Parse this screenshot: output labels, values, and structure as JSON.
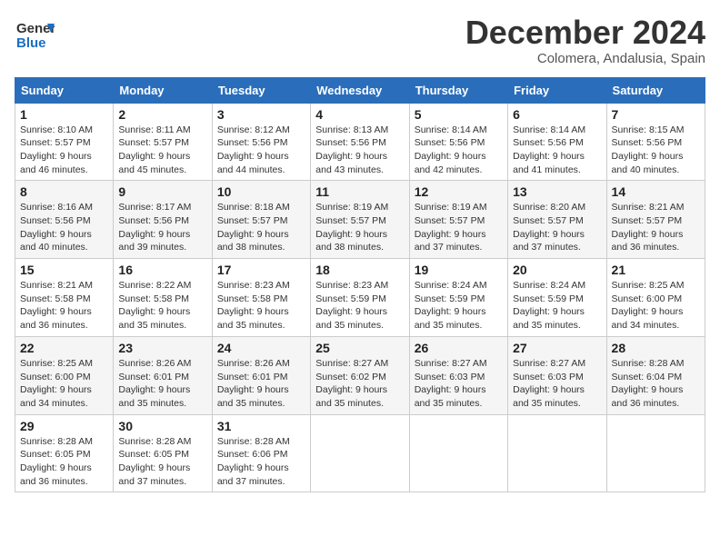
{
  "logo": {
    "line1": "General",
    "line2": "Blue"
  },
  "title": "December 2024",
  "subtitle": "Colomera, Andalusia, Spain",
  "days_of_week": [
    "Sunday",
    "Monday",
    "Tuesday",
    "Wednesday",
    "Thursday",
    "Friday",
    "Saturday"
  ],
  "weeks": [
    [
      {
        "day": "1",
        "info": "Sunrise: 8:10 AM\nSunset: 5:57 PM\nDaylight: 9 hours\nand 46 minutes."
      },
      {
        "day": "2",
        "info": "Sunrise: 8:11 AM\nSunset: 5:57 PM\nDaylight: 9 hours\nand 45 minutes."
      },
      {
        "day": "3",
        "info": "Sunrise: 8:12 AM\nSunset: 5:56 PM\nDaylight: 9 hours\nand 44 minutes."
      },
      {
        "day": "4",
        "info": "Sunrise: 8:13 AM\nSunset: 5:56 PM\nDaylight: 9 hours\nand 43 minutes."
      },
      {
        "day": "5",
        "info": "Sunrise: 8:14 AM\nSunset: 5:56 PM\nDaylight: 9 hours\nand 42 minutes."
      },
      {
        "day": "6",
        "info": "Sunrise: 8:14 AM\nSunset: 5:56 PM\nDaylight: 9 hours\nand 41 minutes."
      },
      {
        "day": "7",
        "info": "Sunrise: 8:15 AM\nSunset: 5:56 PM\nDaylight: 9 hours\nand 40 minutes."
      }
    ],
    [
      {
        "day": "8",
        "info": "Sunrise: 8:16 AM\nSunset: 5:56 PM\nDaylight: 9 hours\nand 40 minutes."
      },
      {
        "day": "9",
        "info": "Sunrise: 8:17 AM\nSunset: 5:56 PM\nDaylight: 9 hours\nand 39 minutes."
      },
      {
        "day": "10",
        "info": "Sunrise: 8:18 AM\nSunset: 5:57 PM\nDaylight: 9 hours\nand 38 minutes."
      },
      {
        "day": "11",
        "info": "Sunrise: 8:19 AM\nSunset: 5:57 PM\nDaylight: 9 hours\nand 38 minutes."
      },
      {
        "day": "12",
        "info": "Sunrise: 8:19 AM\nSunset: 5:57 PM\nDaylight: 9 hours\nand 37 minutes."
      },
      {
        "day": "13",
        "info": "Sunrise: 8:20 AM\nSunset: 5:57 PM\nDaylight: 9 hours\nand 37 minutes."
      },
      {
        "day": "14",
        "info": "Sunrise: 8:21 AM\nSunset: 5:57 PM\nDaylight: 9 hours\nand 36 minutes."
      }
    ],
    [
      {
        "day": "15",
        "info": "Sunrise: 8:21 AM\nSunset: 5:58 PM\nDaylight: 9 hours\nand 36 minutes."
      },
      {
        "day": "16",
        "info": "Sunrise: 8:22 AM\nSunset: 5:58 PM\nDaylight: 9 hours\nand 35 minutes."
      },
      {
        "day": "17",
        "info": "Sunrise: 8:23 AM\nSunset: 5:58 PM\nDaylight: 9 hours\nand 35 minutes."
      },
      {
        "day": "18",
        "info": "Sunrise: 8:23 AM\nSunset: 5:59 PM\nDaylight: 9 hours\nand 35 minutes."
      },
      {
        "day": "19",
        "info": "Sunrise: 8:24 AM\nSunset: 5:59 PM\nDaylight: 9 hours\nand 35 minutes."
      },
      {
        "day": "20",
        "info": "Sunrise: 8:24 AM\nSunset: 5:59 PM\nDaylight: 9 hours\nand 35 minutes."
      },
      {
        "day": "21",
        "info": "Sunrise: 8:25 AM\nSunset: 6:00 PM\nDaylight: 9 hours\nand 34 minutes."
      }
    ],
    [
      {
        "day": "22",
        "info": "Sunrise: 8:25 AM\nSunset: 6:00 PM\nDaylight: 9 hours\nand 34 minutes."
      },
      {
        "day": "23",
        "info": "Sunrise: 8:26 AM\nSunset: 6:01 PM\nDaylight: 9 hours\nand 35 minutes."
      },
      {
        "day": "24",
        "info": "Sunrise: 8:26 AM\nSunset: 6:01 PM\nDaylight: 9 hours\nand 35 minutes."
      },
      {
        "day": "25",
        "info": "Sunrise: 8:27 AM\nSunset: 6:02 PM\nDaylight: 9 hours\nand 35 minutes."
      },
      {
        "day": "26",
        "info": "Sunrise: 8:27 AM\nSunset: 6:03 PM\nDaylight: 9 hours\nand 35 minutes."
      },
      {
        "day": "27",
        "info": "Sunrise: 8:27 AM\nSunset: 6:03 PM\nDaylight: 9 hours\nand 35 minutes."
      },
      {
        "day": "28",
        "info": "Sunrise: 8:28 AM\nSunset: 6:04 PM\nDaylight: 9 hours\nand 36 minutes."
      }
    ],
    [
      {
        "day": "29",
        "info": "Sunrise: 8:28 AM\nSunset: 6:05 PM\nDaylight: 9 hours\nand 36 minutes."
      },
      {
        "day": "30",
        "info": "Sunrise: 8:28 AM\nSunset: 6:05 PM\nDaylight: 9 hours\nand 37 minutes."
      },
      {
        "day": "31",
        "info": "Sunrise: 8:28 AM\nSunset: 6:06 PM\nDaylight: 9 hours\nand 37 minutes."
      },
      {
        "day": "",
        "info": ""
      },
      {
        "day": "",
        "info": ""
      },
      {
        "day": "",
        "info": ""
      },
      {
        "day": "",
        "info": ""
      }
    ]
  ]
}
